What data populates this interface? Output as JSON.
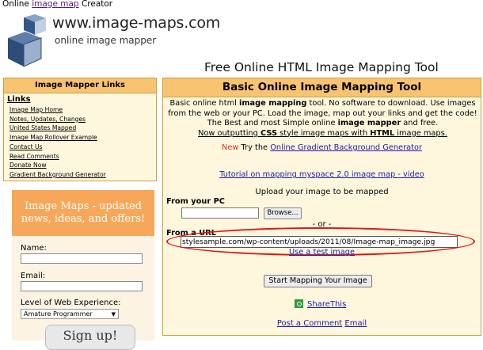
{
  "top": {
    "prefix": "Online",
    "link": "image map",
    "suffix": "Creator"
  },
  "logo": {
    "title": "www.image-maps.com",
    "subtitle": "online image mapper"
  },
  "page_heading": "Free Online HTML Image Mapping Tool",
  "sidebar": {
    "header": "Image Mapper Links",
    "links_title": "Links",
    "items": [
      "Image Map Home",
      "Notes, Updates, Changes",
      "United States Mapped",
      "Image Map Rollover Example",
      "Contact Us",
      "Read Comments",
      "Donate Now",
      "Gradient Background Generator"
    ]
  },
  "news": {
    "banner_line1": "Image Maps - updated",
    "banner_line2": "news, ideas, and offers!",
    "name_label": "Name:",
    "email_label": "Email:",
    "experience_label": "Level of Web Experience:",
    "experience_value": "Amature Programmer",
    "signup_label": "Sign up!"
  },
  "main": {
    "header": "Basic Online Image Mapping Tool",
    "intro": {
      "p1": "Basic online html ",
      "b1": "image mapping",
      "p2": " tool. No software to download. Use images from the web or your PC. Load the image, map out your links and get the code! The Best and most Simple online ",
      "b2": "image mapper",
      "p3": " and free.",
      "u1": "Now outputting ",
      "ub1": "CSS",
      "u2": " style image maps with ",
      "ub2": "HTML",
      "u3": " image maps."
    },
    "new_label": "New",
    "try_text": " Try the ",
    "gradient_link": "Online Gradient Background Generator",
    "tutorial_link": "Tutorial on mapping myspace 2.0 image map - video",
    "upload_label": "Upload your image to be mapped",
    "from_pc": "From your PC",
    "browse": "Browse...",
    "or_sep": "- or -",
    "from_url": "From a URL",
    "url_value": "stylesample.com/wp-content/uploads/2011/08/Image-map_image.jpg",
    "test_image": "Use a test image",
    "start_button": "Start Mapping Your Image",
    "share": "ShareThis",
    "post_comment": "Post a Comment",
    "email": "Email"
  },
  "colors": {
    "accent": "#f9c472",
    "panel_bg": "#fff7dd",
    "border": "#d39c3d",
    "highlight": "#e0141c",
    "link": "#1a1aa8"
  }
}
